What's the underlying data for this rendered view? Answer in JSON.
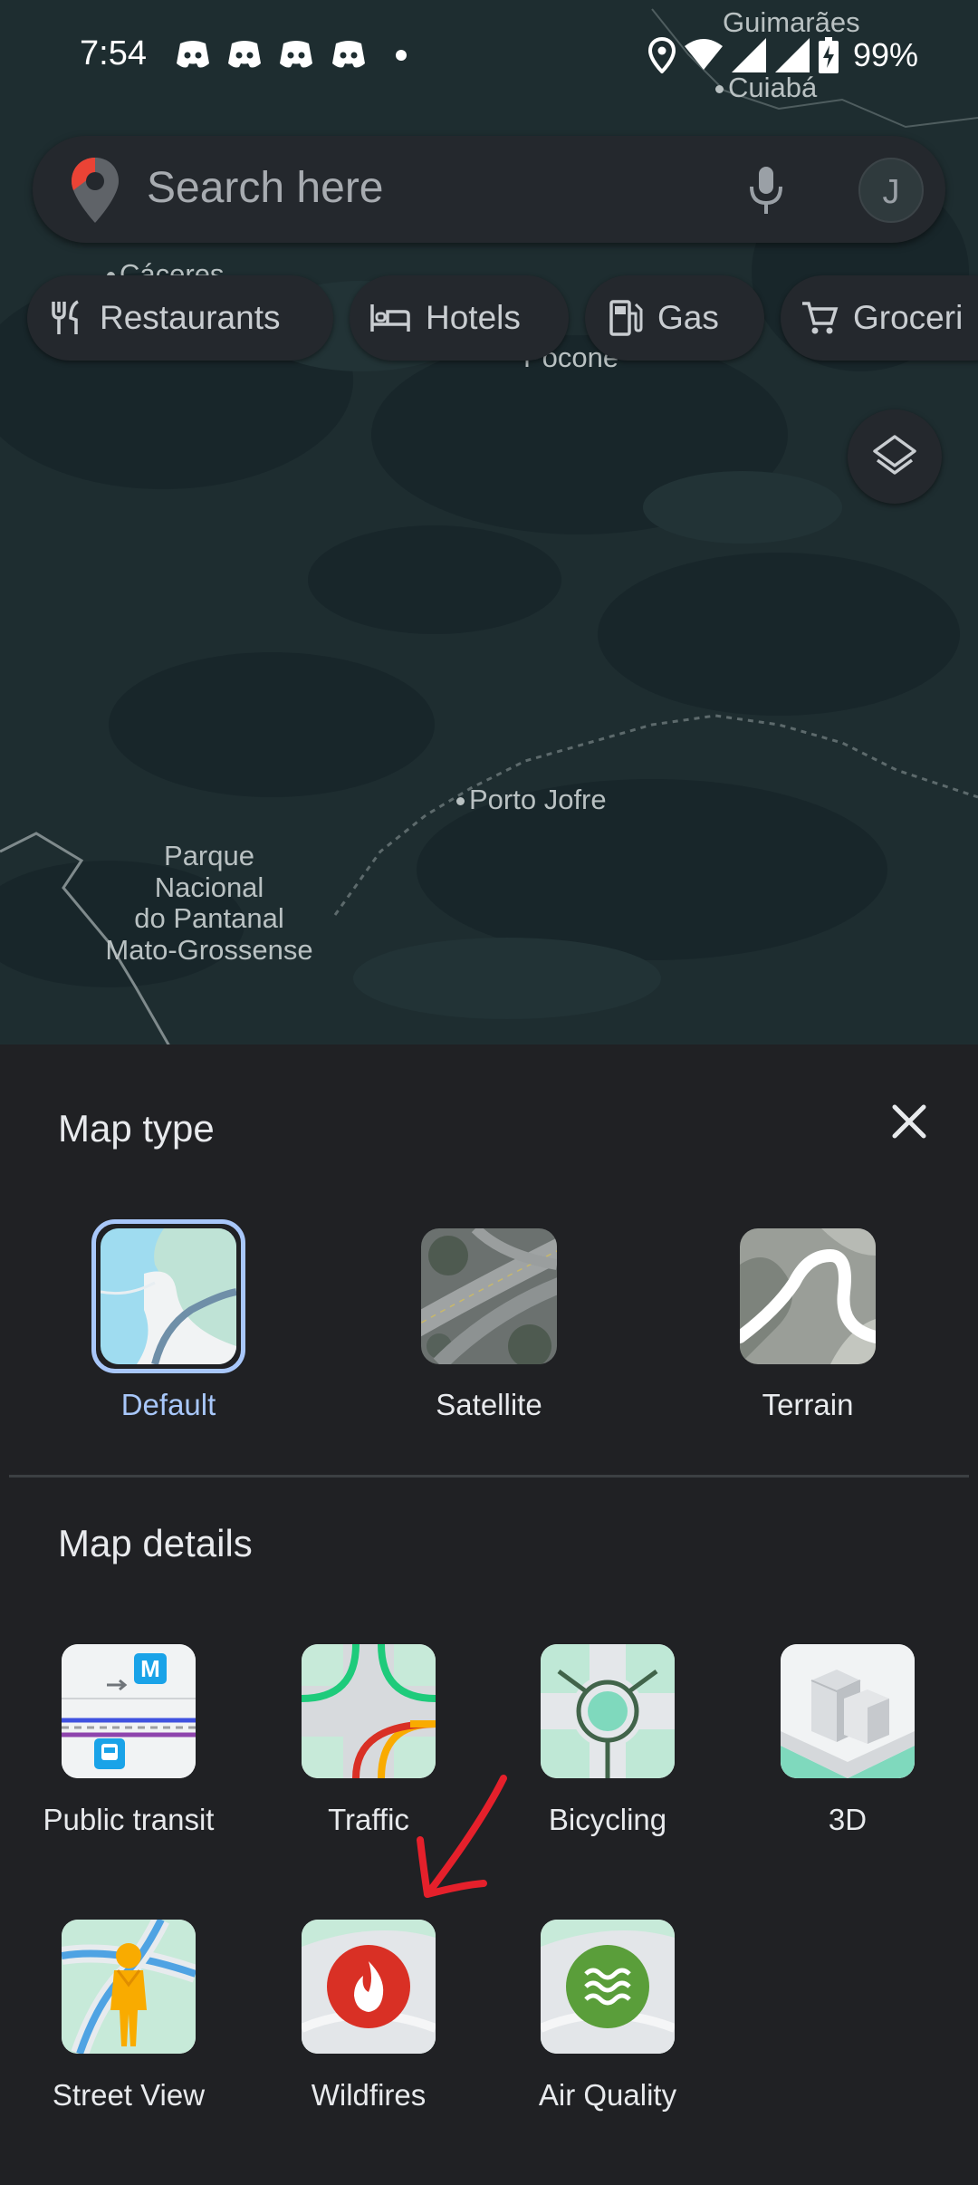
{
  "status_bar": {
    "time": "7:54",
    "battery_percent": "99%",
    "notification_icons": [
      "discord-icon",
      "discord-icon",
      "discord-icon",
      "discord-icon",
      "dot-icon"
    ],
    "system_icons": [
      "location-icon",
      "wifi-icon",
      "signal-icon",
      "signal-icon",
      "battery-charging-icon"
    ]
  },
  "map": {
    "labels": {
      "guimaraes": "Guimarães",
      "cuiaba": "Cuiabá",
      "caceres": "Cáceres",
      "pocone": "Poconé",
      "porto_jofre": "Porto Jofre",
      "park": "Parque\nNacional\ndo Pantanal\nMato-Grossense"
    },
    "colors": {
      "background": "#1e2d30",
      "label": "#b9c1c2"
    }
  },
  "search": {
    "placeholder": "Search here",
    "avatar_letter": "J",
    "icons": [
      "maps-pin-icon",
      "microphone-icon"
    ]
  },
  "chips": [
    {
      "label": "Restaurants",
      "icon": "fork-knife-icon"
    },
    {
      "label": "Hotels",
      "icon": "bed-icon"
    },
    {
      "label": "Gas",
      "icon": "gas-pump-icon"
    },
    {
      "label": "Groceri",
      "icon": "cart-icon"
    }
  ],
  "sheet": {
    "map_type_title": "Map type",
    "map_details_title": "Map details",
    "map_types": [
      {
        "label": "Default",
        "selected": true
      },
      {
        "label": "Satellite",
        "selected": false
      },
      {
        "label": "Terrain",
        "selected": false
      }
    ],
    "map_details": [
      {
        "label": "Public transit"
      },
      {
        "label": "Traffic"
      },
      {
        "label": "Bicycling"
      },
      {
        "label": "3D"
      },
      {
        "label": "Street View"
      },
      {
        "label": "Wildfires"
      },
      {
        "label": "Air Quality"
      }
    ],
    "colors": {
      "selected": "#a8c7fa",
      "sheet_bg": "#202124",
      "annotation_arrow": "#e5202b"
    }
  }
}
